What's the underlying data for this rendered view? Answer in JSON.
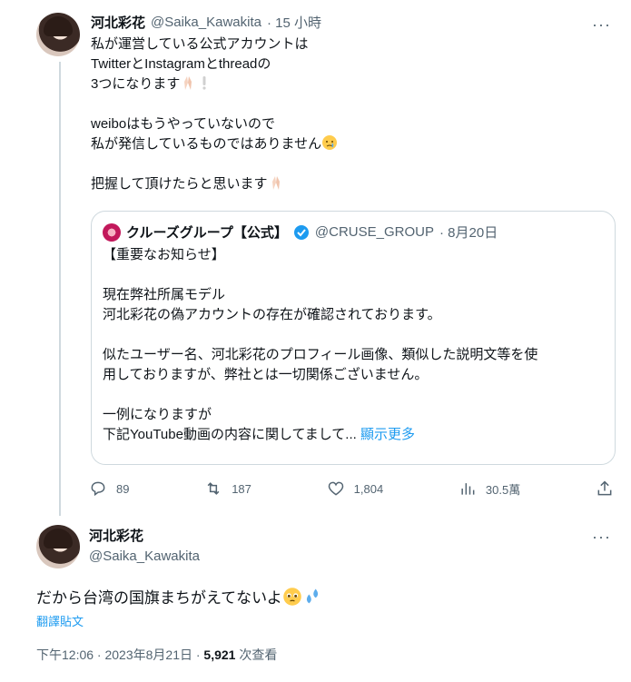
{
  "reply_tweet": {
    "name": "河北彩花",
    "handle": "@Saika_Kawakita",
    "time": "· 15 小時",
    "lines": [
      "私が運営している公式アカウントは",
      "TwitterとInstagramとthreadの",
      "3つになります",
      "",
      "weiboはもうやっていないので",
      "私が発信しているものではありません",
      "",
      "把握して頂けたらと思います"
    ],
    "quote": {
      "name": "クルーズグループ【公式】",
      "handle": "@CRUSE_GROUP",
      "date": "· 8月20日",
      "lines": [
        "【重要なお知らせ】",
        "",
        "現在弊社所属モデル",
        "河北彩花の偽アカウントの存在が確認されております。",
        "",
        "似たユーザー名、河北彩花のプロフィール画像、類似した説明文等を使",
        "用しておりますが、弊社とは一切関係ございません。",
        "",
        "一例になりますが"
      ],
      "last_line": "下記YouTube動画の内容に関してまして...",
      "show_more": "顯示更多"
    },
    "actions": {
      "replies": "89",
      "retweets": "187",
      "likes": "1,804",
      "views": "30.5萬"
    }
  },
  "main_tweet": {
    "name": "河北彩花",
    "handle": "@Saika_Kawakita",
    "text": "だから台湾の国旗まちがえてないよ",
    "translate": "翻譯貼文",
    "timestamp": "下午12:06 · 2023年8月21日 · ",
    "views_count": "5,921",
    "views_label": " 次查看"
  }
}
